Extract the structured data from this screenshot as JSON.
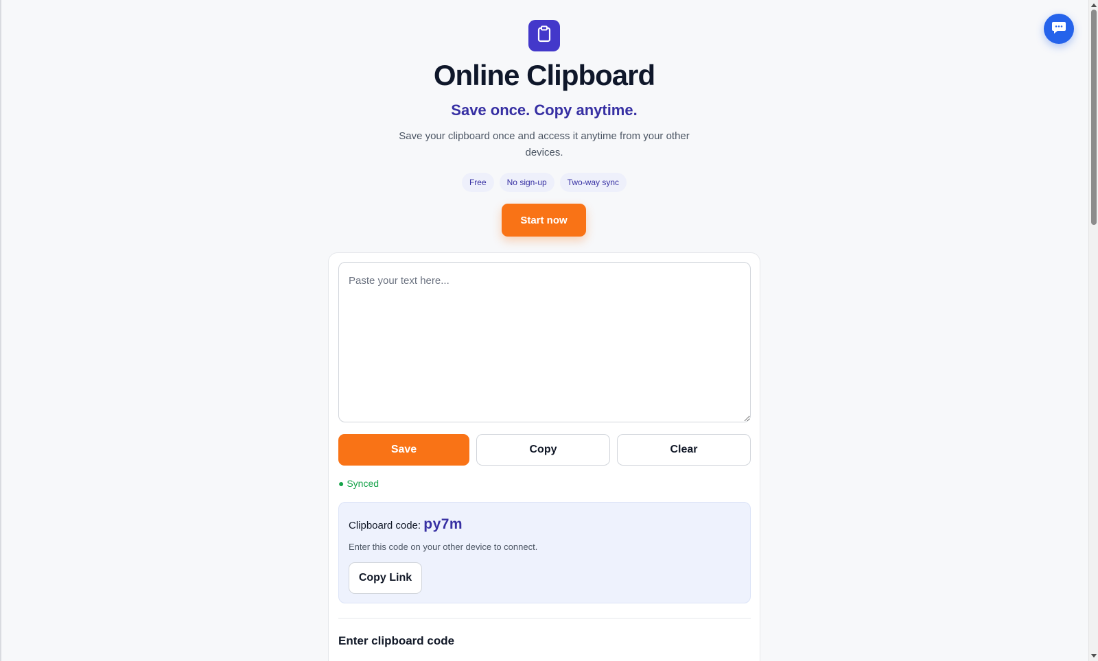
{
  "app": {
    "title": "Online Clipboard",
    "tagline": "Save once. Copy anytime.",
    "description": "Save your clipboard once and access it anytime from your other devices.",
    "logo_icon": "clipboard-icon"
  },
  "features": [
    "Free",
    "No sign-up",
    "Two-way sync"
  ],
  "start_button": {
    "label": "Start now"
  },
  "editor": {
    "placeholder": "Paste your text here...",
    "value": ""
  },
  "actions": {
    "save_label": "Save",
    "copy_label": "Copy",
    "clear_label": "Clear"
  },
  "status": {
    "text": "● Synced",
    "color": "#16a34a"
  },
  "code_panel": {
    "label": "Clipboard code:",
    "code": "py7m",
    "help": "Enter this code on your other device to connect.",
    "copy_link_label": "Copy Link"
  },
  "enter_code": {
    "heading": "Enter clipboard code"
  },
  "chat": {
    "icon": "chat-bubble-icon"
  },
  "colors": {
    "brand": "#4338ca",
    "accent": "#f97316",
    "tagline": "#3730a3",
    "chat": "#2563eb",
    "synced": "#16a34a"
  }
}
